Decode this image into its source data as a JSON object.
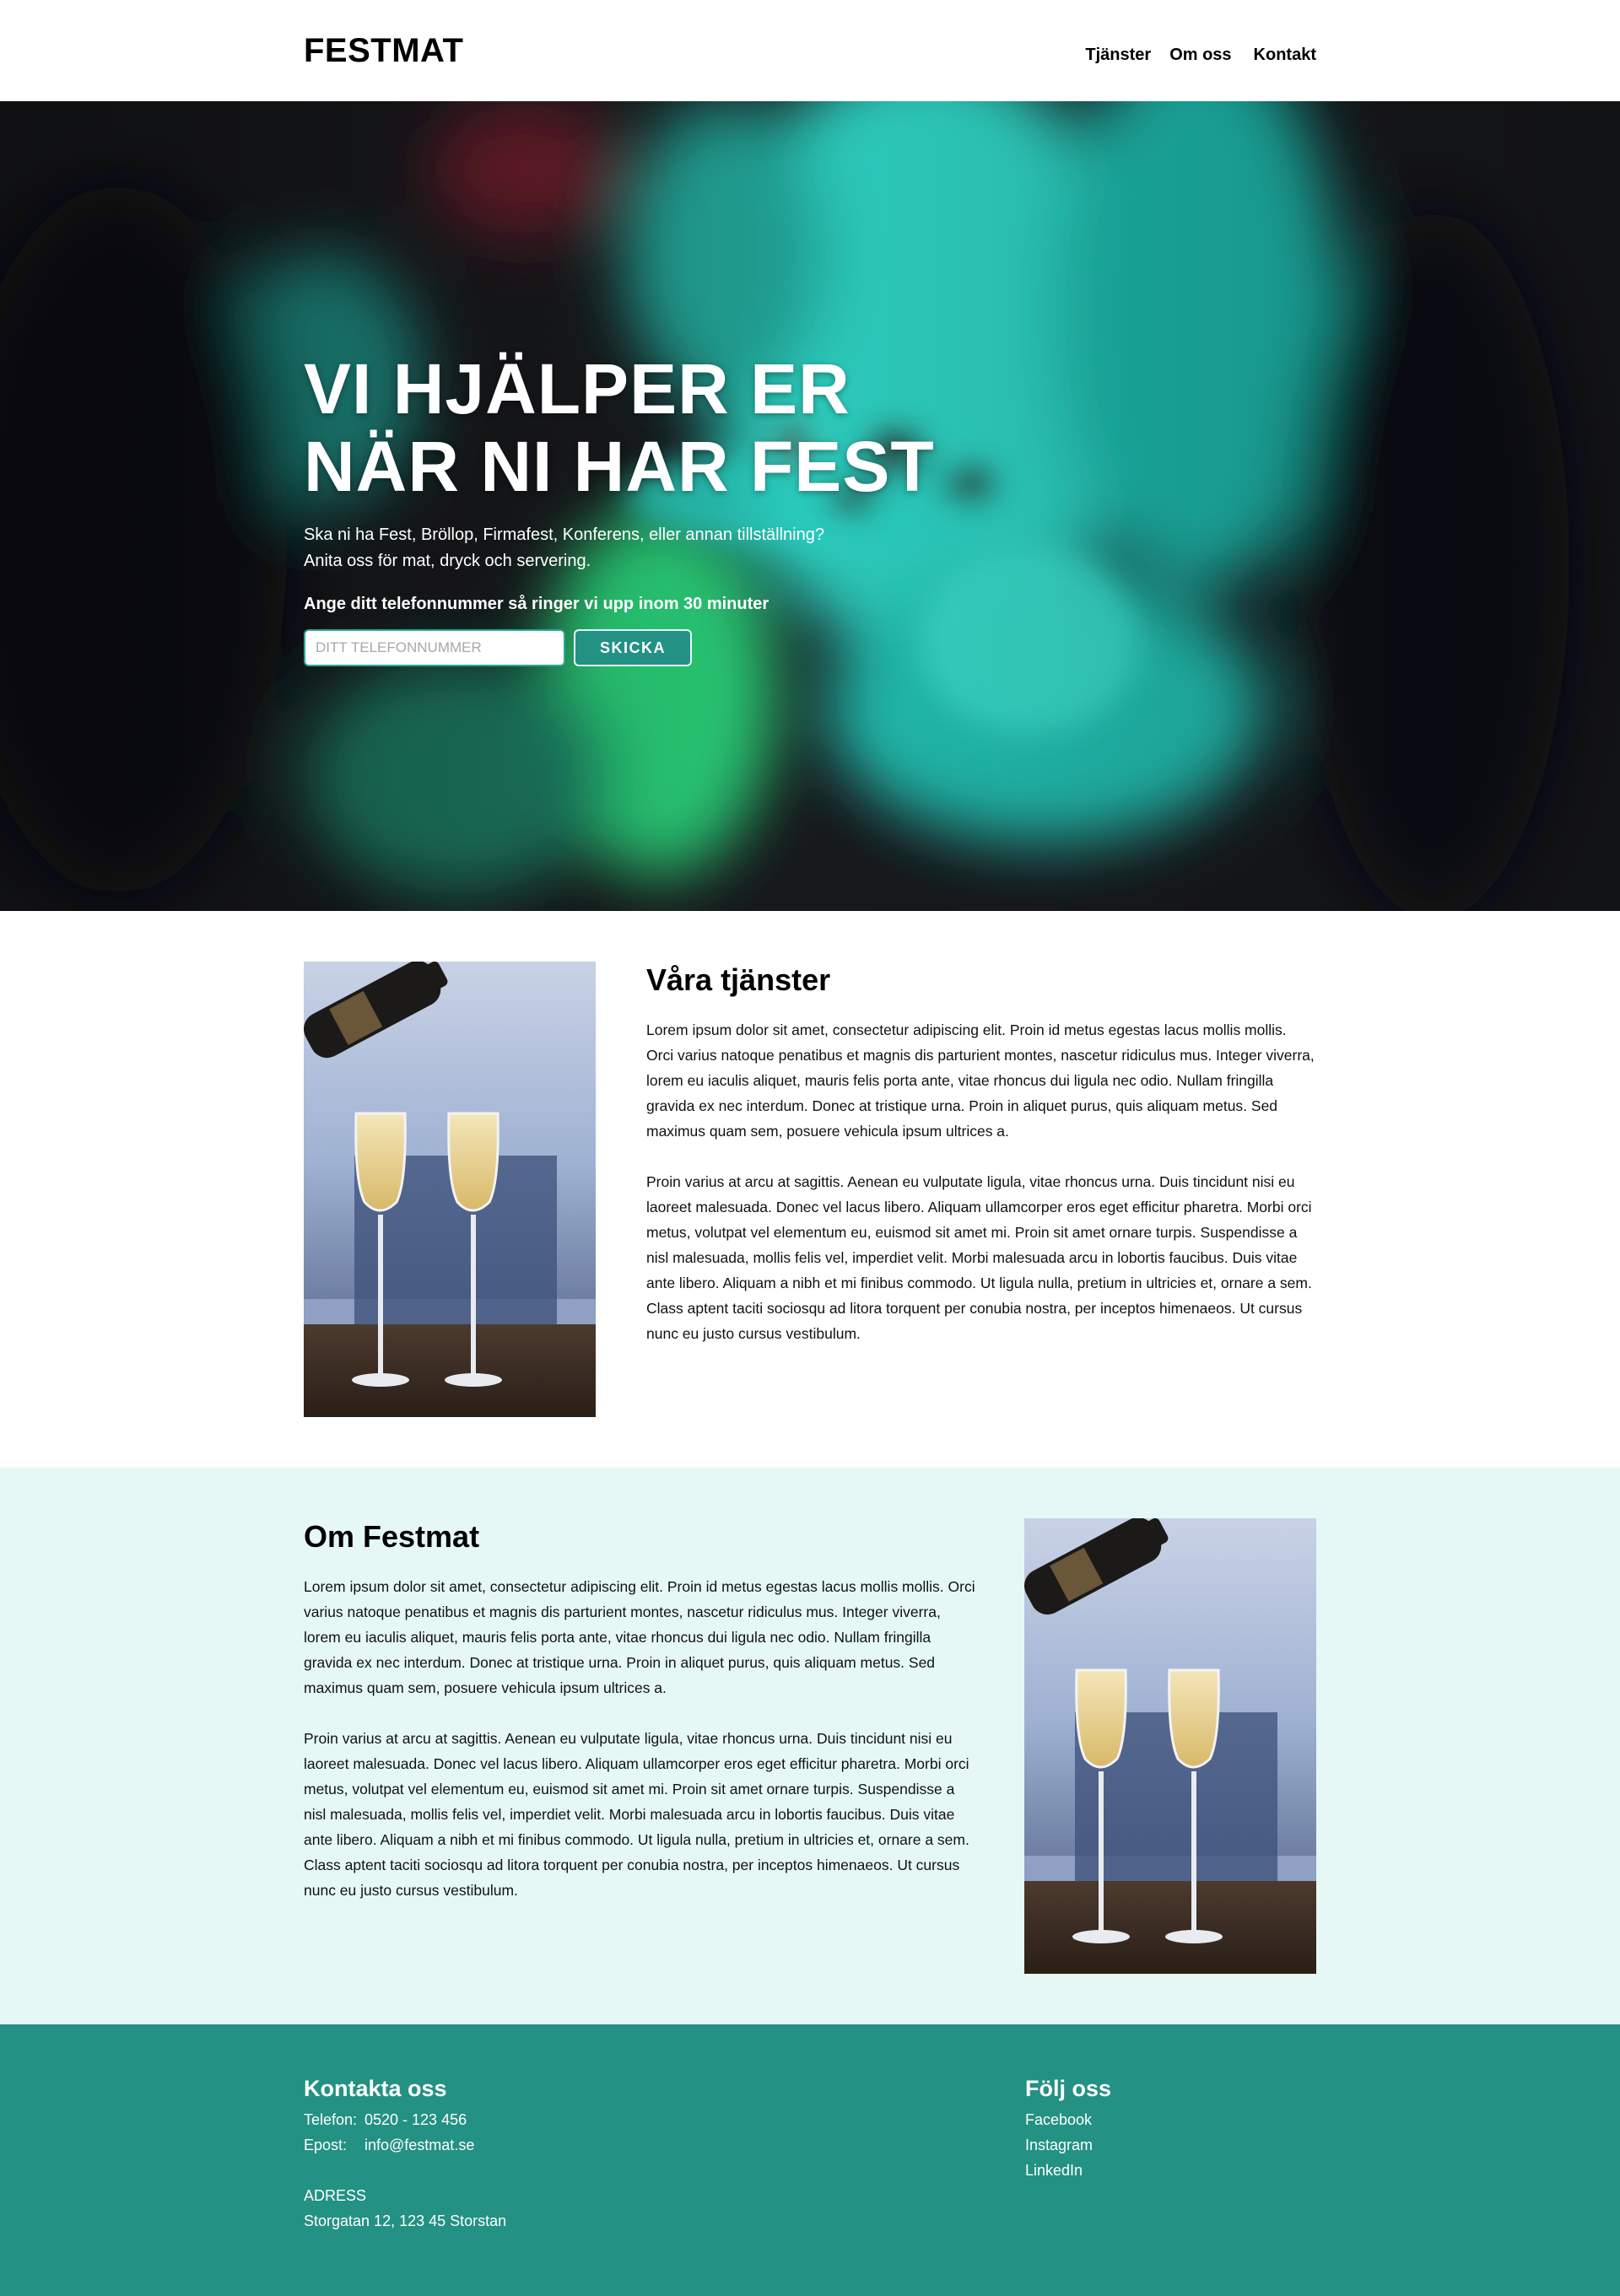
{
  "header": {
    "logo": "FESTMAT",
    "nav": [
      "Tjänster",
      "Om oss",
      "Kontakt"
    ]
  },
  "hero": {
    "title_line1": "VI HJÄLPER ER",
    "title_line2": "NÄR NI HAR FEST",
    "subtitle_line1": "Ska ni ha Fest, Bröllop, Firmafest, Konferens, eller annan tillställning?",
    "subtitle_line2": "Anita oss för mat, dryck och servering.",
    "cta_label": "Ange ditt telefonnummer så ringer vi upp inom 30 minuter",
    "phone_placeholder": "DITT TELEFONNUMMER",
    "submit_label": "SKICKA"
  },
  "services": {
    "title": "Våra tjänster",
    "paragraphs": [
      "Lorem ipsum dolor sit amet, consectetur adipiscing elit. Proin id metus egestas lacus mollis mollis. Orci varius natoque penatibus et magnis dis parturient montes, nascetur ridiculus mus. Integer viverra, lorem eu iaculis aliquet, mauris felis porta ante, vitae rhoncus dui ligula nec odio. Nullam fringilla gravida ex nec interdum. Donec at tristique urna. Proin in aliquet purus, quis aliquam metus. Sed maximus quam sem, posuere vehicula ipsum ultrices a.",
      "Proin varius at arcu at sagittis. Aenean eu vulputate ligula, vitae rhoncus urna. Duis tincidunt nisi eu laoreet malesuada. Donec vel lacus libero. Aliquam ullamcorper eros eget efficitur pharetra. Morbi orci metus, volutpat vel elementum eu, euismod sit amet mi. Proin sit amet ornare turpis. Suspendisse a nisl malesuada, mollis felis vel, imperdiet velit. Morbi malesuada arcu in lobortis faucibus. Duis vitae ante libero. Aliquam a nibh et mi finibus commodo. Ut ligula nulla, pretium in ultricies et, ornare a sem. Class aptent taciti sociosqu ad litora torquent per conubia nostra, per inceptos himenaeos. Ut cursus nunc eu justo cursus vestibulum."
    ]
  },
  "about": {
    "title": "Om Festmat",
    "paragraphs": [
      "Lorem ipsum dolor sit amet, consectetur adipiscing elit. Proin id metus egestas lacus mollis mollis. Orci varius natoque penatibus et magnis dis parturient montes, nascetur ridiculus mus. Integer viverra, lorem eu iaculis aliquet, mauris felis porta ante, vitae rhoncus dui ligula nec odio. Nullam fringilla gravida ex nec interdum. Donec at tristique urna. Proin in aliquet purus, quis aliquam metus. Sed maximus quam sem, posuere vehicula ipsum ultrices a.",
      "Proin varius at arcu at sagittis. Aenean eu vulputate ligula, vitae rhoncus urna. Duis tincidunt nisi eu laoreet malesuada. Donec vel lacus libero. Aliquam ullamcorper eros eget efficitur pharetra. Morbi orci metus, volutpat vel elementum eu, euismod sit amet mi. Proin sit amet ornare turpis. Suspendisse a nisl malesuada, mollis felis vel, imperdiet velit. Morbi malesuada arcu in lobortis faucibus. Duis vitae ante libero. Aliquam a nibh et mi finibus commodo. Ut ligula nulla, pretium in ultricies et, ornare a sem. Class aptent taciti sociosqu ad litora torquent per conubia nostra, per inceptos himenaeos. Ut cursus nunc eu justo cursus vestibulum."
    ]
  },
  "footer": {
    "contact_title": "Kontakta oss",
    "phone_label": "Telefon:",
    "phone_value": "0520 - 123 456",
    "email_label": "Epost:",
    "email_value": "info@festmat.se",
    "address_label": "ADRESS",
    "address_value": "Storgatan 12, 123 45 Storstan",
    "follow_title": "Följ oss",
    "social": [
      "Facebook",
      "Instagram",
      "LinkedIn"
    ]
  },
  "colors": {
    "brand_teal": "#239183",
    "about_bg": "#e6f8f6",
    "hero_bg": "#18191c"
  }
}
